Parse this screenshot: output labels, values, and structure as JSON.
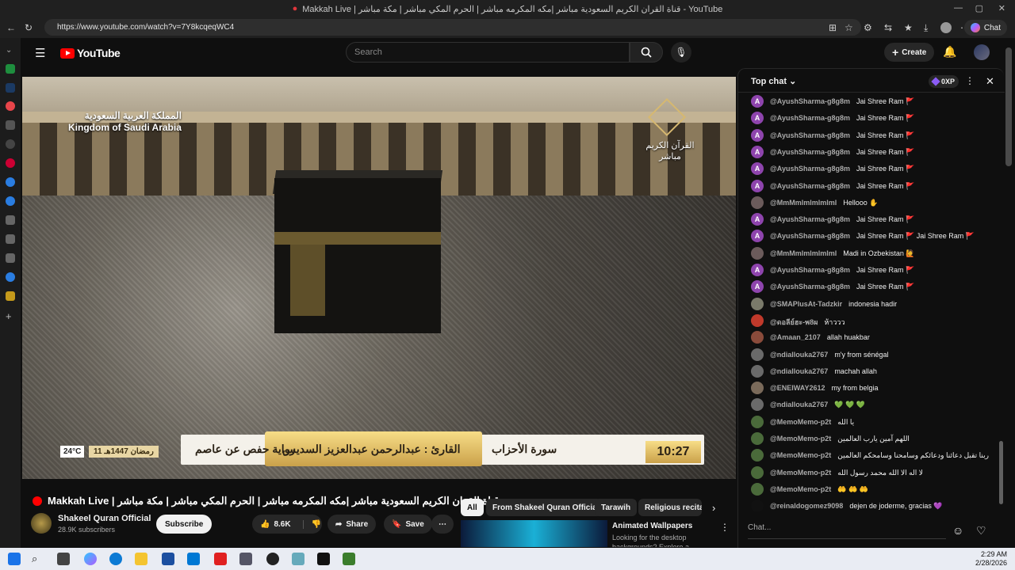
{
  "browser": {
    "window_title": "Makkah Live | قناة القران الكريم السعودية مباشر |مكه المكرمه مباشر | الحرم المكي مباشر | مكة مباشر - YouTube",
    "url": "https://www.youtube.com/watch?v=7Y8kcqeqWC4",
    "chat_button": "Chat"
  },
  "youtube": {
    "logo": "YouTube",
    "search_placeholder": "Search",
    "create_label": "Create"
  },
  "video": {
    "overlay_top_left": "المملكة العربية السعودية",
    "overlay_top_left_en": "Kingdom of Saudi Arabia",
    "overlay_logo_text": "القرآن الكريم",
    "overlay_logo_sub": "مباشر",
    "temperature": "24°C",
    "hijri_date": "11 رمضان 1447هـ",
    "riwaya": "رواية حفص عن عاصم",
    "reciter": "القارئ : عبدالرحمن عبدالعزيز السديس",
    "surah": "سورة الأحزاب",
    "time": "10:27"
  },
  "meta": {
    "title": "Makkah Live | قناة القران الكريم السعودية مباشر |مكه المكرمه مباشر | الحرم المكي مباشر | مكة مباشر",
    "channel": "Shakeel Quran Official",
    "subscribers": "28.9K subscribers",
    "subscribe_label": "Subscribe",
    "likes": "8.6K",
    "share_label": "Share",
    "save_label": "Save"
  },
  "chips": [
    "All",
    "From Shakeel Quran Official",
    "Tarawih",
    "Religious recitat"
  ],
  "recommendation": {
    "title": "Animated Wallpapers",
    "desc": "Looking for the desktop backgrounds? Explore a curated"
  },
  "chat": {
    "header": "Top chat",
    "xp": "0XP",
    "input_placeholder": "Chat...",
    "messages": [
      {
        "author": "@AyushSharma-g8g8m",
        "text": "Jai Shree Ram 🚩",
        "avatar": "A",
        "color": "#8e44ad"
      },
      {
        "author": "@AyushSharma-g8g8m",
        "text": "Jai Shree Ram 🚩",
        "avatar": "A",
        "color": "#8e44ad"
      },
      {
        "author": "@AyushSharma-g8g8m",
        "text": "Jai Shree Ram 🚩",
        "avatar": "A",
        "color": "#8e44ad"
      },
      {
        "author": "@AyushSharma-g8g8m",
        "text": "Jai Shree Ram 🚩",
        "avatar": "A",
        "color": "#8e44ad"
      },
      {
        "author": "@AyushSharma-g8g8m",
        "text": "Jai Shree Ram 🚩",
        "avatar": "A",
        "color": "#8e44ad"
      },
      {
        "author": "@AyushSharma-g8g8m",
        "text": "Jai Shree Ram 🚩",
        "avatar": "A",
        "color": "#8e44ad"
      },
      {
        "author": "@MmMmlmlmlmlml",
        "text": "Hellooo ✋",
        "avatar": "",
        "color": "#6b5b5b"
      },
      {
        "author": "@AyushSharma-g8g8m",
        "text": "Jai Shree Ram 🚩",
        "avatar": "A",
        "color": "#8e44ad"
      },
      {
        "author": "@AyushSharma-g8g8m",
        "text": "Jai Shree Ram 🚩 Jai Shree Ram 🚩",
        "avatar": "A",
        "color": "#8e44ad"
      },
      {
        "author": "@MmMmlmlmlmlml",
        "text": "Madi in Ozbekistan 🙋",
        "avatar": "",
        "color": "#6b5b5b"
      },
      {
        "author": "@AyushSharma-g8g8m",
        "text": "Jai Shree Ram 🚩",
        "avatar": "A",
        "color": "#8e44ad"
      },
      {
        "author": "@AyushSharma-g8g8m",
        "text": "Jai Shree Ram 🚩",
        "avatar": "A",
        "color": "#8e44ad"
      },
      {
        "author": "@SMAPlusAt-Tadzkir",
        "text": "indonesia hadir",
        "avatar": "",
        "color": "#7a7a6a"
      },
      {
        "author": "@ดอลีย์ฮะ-พ8ผ",
        "text": "ห้าววว",
        "avatar": "",
        "color": "#c0392b"
      },
      {
        "author": "@Amaan_2107",
        "text": "allah huakbar",
        "avatar": "",
        "color": "#8a4b3b"
      },
      {
        "author": "@ndiallouka2767",
        "text": "m'y from sénégal",
        "avatar": "",
        "color": "#6a6a6a"
      },
      {
        "author": "@ndiallouka2767",
        "text": "machah allah",
        "avatar": "",
        "color": "#6a6a6a"
      },
      {
        "author": "@ENEIWAY2612",
        "text": "my from belgia",
        "avatar": "",
        "color": "#7a6a5a"
      },
      {
        "author": "@ndiallouka2767",
        "text": "💚 💚 💚",
        "avatar": "",
        "color": "#6a6a6a"
      },
      {
        "author": "@MemoMemo-p2t",
        "text": "يا الله",
        "avatar": "",
        "color": "#4a6a3a"
      },
      {
        "author": "@MemoMemo-p2t",
        "text": "اللهم آمين يارب العالمين",
        "avatar": "",
        "color": "#4a6a3a"
      },
      {
        "author": "@MemoMemo-p2t",
        "text": "ربنا تقبل دعائنا ودعائكم وسامحنا وسامحكم العالمين",
        "avatar": "",
        "color": "#4a6a3a"
      },
      {
        "author": "@MemoMemo-p2t",
        "text": "لا اله الا الله محمد رسول الله",
        "avatar": "",
        "color": "#4a6a3a"
      },
      {
        "author": "@MemoMemo-p2t",
        "text": "🤲 🤲 🤲",
        "avatar": "",
        "color": "#4a6a3a"
      },
      {
        "author": "@reinaldogomez9098",
        "text": "dejen de joderme, gracias 💜",
        "avatar": "",
        "color": "#111111"
      }
    ]
  },
  "taskbar": {
    "time": "2:29 AM",
    "date": "2/28/2026"
  }
}
